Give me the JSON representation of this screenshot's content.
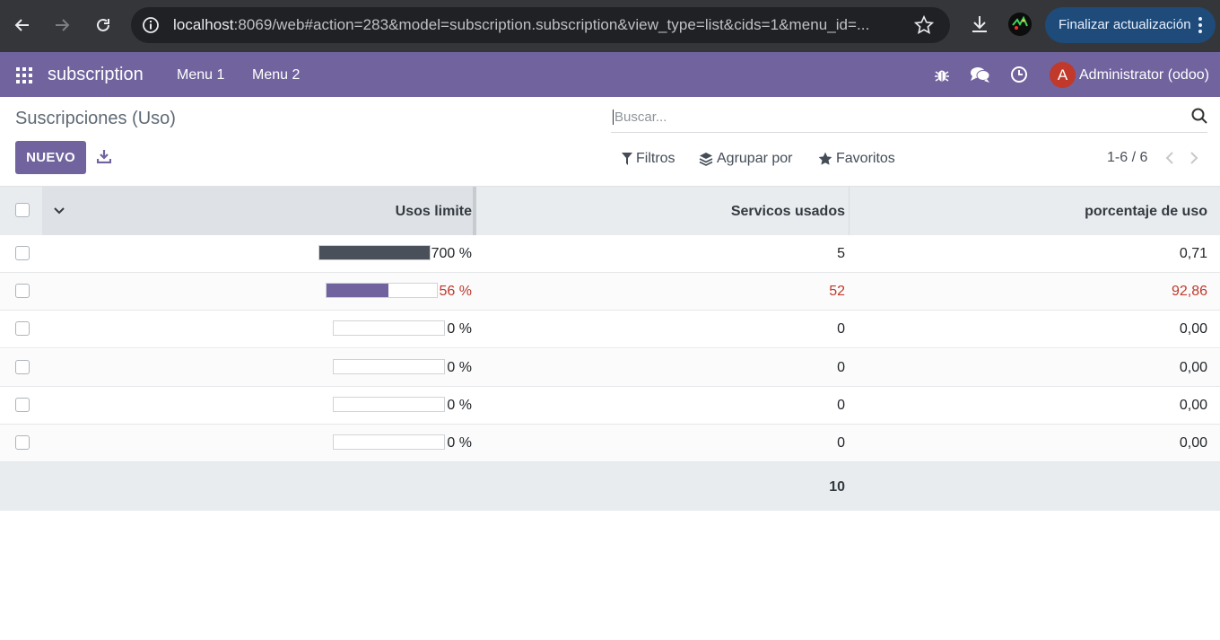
{
  "browser": {
    "url_host": "localhost",
    "url_rest": ":8069/web#action=283&model=subscription.subscription&view_type=list&cids=1&menu_id=...",
    "update_label": "Finalizar actualización"
  },
  "navbar": {
    "app_name": "subscription",
    "menus": [
      "Menu 1",
      "Menu 2"
    ],
    "avatar_letter": "A",
    "user_name": "Administrator (odoo)",
    "avatar_color": "#c0392b"
  },
  "control": {
    "title": "Suscripciones (Uso)",
    "new_label": "NUEVO",
    "search_placeholder": "Buscar...",
    "filters_label": "Filtros",
    "groupby_label": "Agrupar por",
    "favorites_label": "Favoritos",
    "pager": "1-6 / 6"
  },
  "table": {
    "headers": {
      "usos_limite": "Usos limite",
      "servicios_usados": "Servicos usados",
      "porcentaje": "porcentaje de uso"
    },
    "rows": [
      {
        "progress": 1.0,
        "pct": "700 %",
        "used": "5",
        "percent": "0,71",
        "warn": false
      },
      {
        "progress": 0.56,
        "pct": "56 %",
        "used": "52",
        "percent": "92,86",
        "warn": true
      },
      {
        "progress": 0.0,
        "pct": "0 %",
        "used": "0",
        "percent": "0,00",
        "warn": false
      },
      {
        "progress": 0.0,
        "pct": "0 %",
        "used": "0",
        "percent": "0,00",
        "warn": false
      },
      {
        "progress": 0.0,
        "pct": "0 %",
        "used": "0",
        "percent": "0,00",
        "warn": false
      },
      {
        "progress": 0.0,
        "pct": "0 %",
        "used": "0",
        "percent": "0,00",
        "warn": false
      }
    ],
    "total_used": "10"
  },
  "colors": {
    "brand": "#71639e",
    "overflow_bar": "#4a5059",
    "warning_text": "#c0392b"
  }
}
